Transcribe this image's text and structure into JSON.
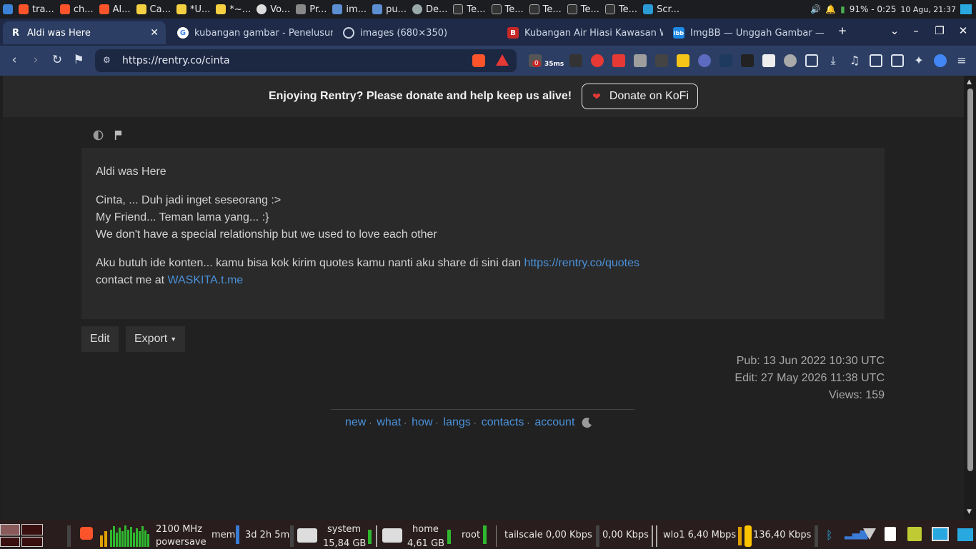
{
  "os_panel": {
    "tasks": [
      "tra...",
      "ch...",
      "Al...",
      "Ca...",
      "*U...",
      "*~...",
      "Vo...",
      "Pr...",
      "im...",
      "pu...",
      "De...",
      "Te...",
      "Te...",
      "Te...",
      "Te...",
      "Te...",
      "Te...",
      "Scr..."
    ],
    "battery": "91% - 0:25",
    "clock": "10 Agu, 21:37"
  },
  "tabs": [
    {
      "title": "Aldi was Here",
      "favicon": "rentry-icon"
    },
    {
      "title": "kubangan gambar - Penelusur",
      "favicon": "google-icon"
    },
    {
      "title": "images (680×350)",
      "favicon": "globe-icon"
    },
    {
      "title": "Kubangan Air Hiasi Kawasan W",
      "favicon": "b-icon"
    },
    {
      "title": "ImgBB — Unggah Gambar —",
      "favicon": "imgbb-icon"
    }
  ],
  "toolbar": {
    "url": "https://rentry.co/cinta",
    "ext_badge": "0",
    "ext_latency": "35ms"
  },
  "donate": {
    "text": "Enjoying Rentry? Please donate and help keep us alive!",
    "button": "Donate on KoFi"
  },
  "content": {
    "heading": "Aldi was Here",
    "line1": "Cinta, ... Duh jadi inget seseorang :>",
    "line2": "My Friend... Teman lama yang... :}",
    "line3": "We don't have a special relationship but we used to love each other",
    "line4_prefix": "Aku butuh ide konten... kamu bisa kok kirim quotes kamu nanti aku share di sini dan",
    "line4_link": "https://rentry.co/quotes",
    "line5_prefix": "contact me at",
    "line5_link": "WASKITA.t.me"
  },
  "actions": {
    "edit": "Edit",
    "export": "Export"
  },
  "meta": {
    "pub": "Pub: 13 Jun 2022 10:30 UTC",
    "edit": "Edit: 27 May 2026 11:38 UTC",
    "views": "Views: 159"
  },
  "footer": {
    "links": [
      "new",
      "what",
      "how",
      "langs",
      "contacts",
      "account"
    ]
  },
  "bottom_panel": {
    "cpu_freq": "2100 MHz",
    "governor": "powersave",
    "mem_label": "mem",
    "uptime": "3d 2h 5m",
    "system_label": "system",
    "system_size": "15,84 GB",
    "home_label": "home",
    "home_size": "4,61 GB",
    "root_label": "root",
    "tailscale": "tailscale 0,00 Kbps",
    "ts_up": "0,00 Kbps",
    "wlo1": "wlo1  6,40 Mbps",
    "wlo1_up": "136,40 Kbps"
  }
}
